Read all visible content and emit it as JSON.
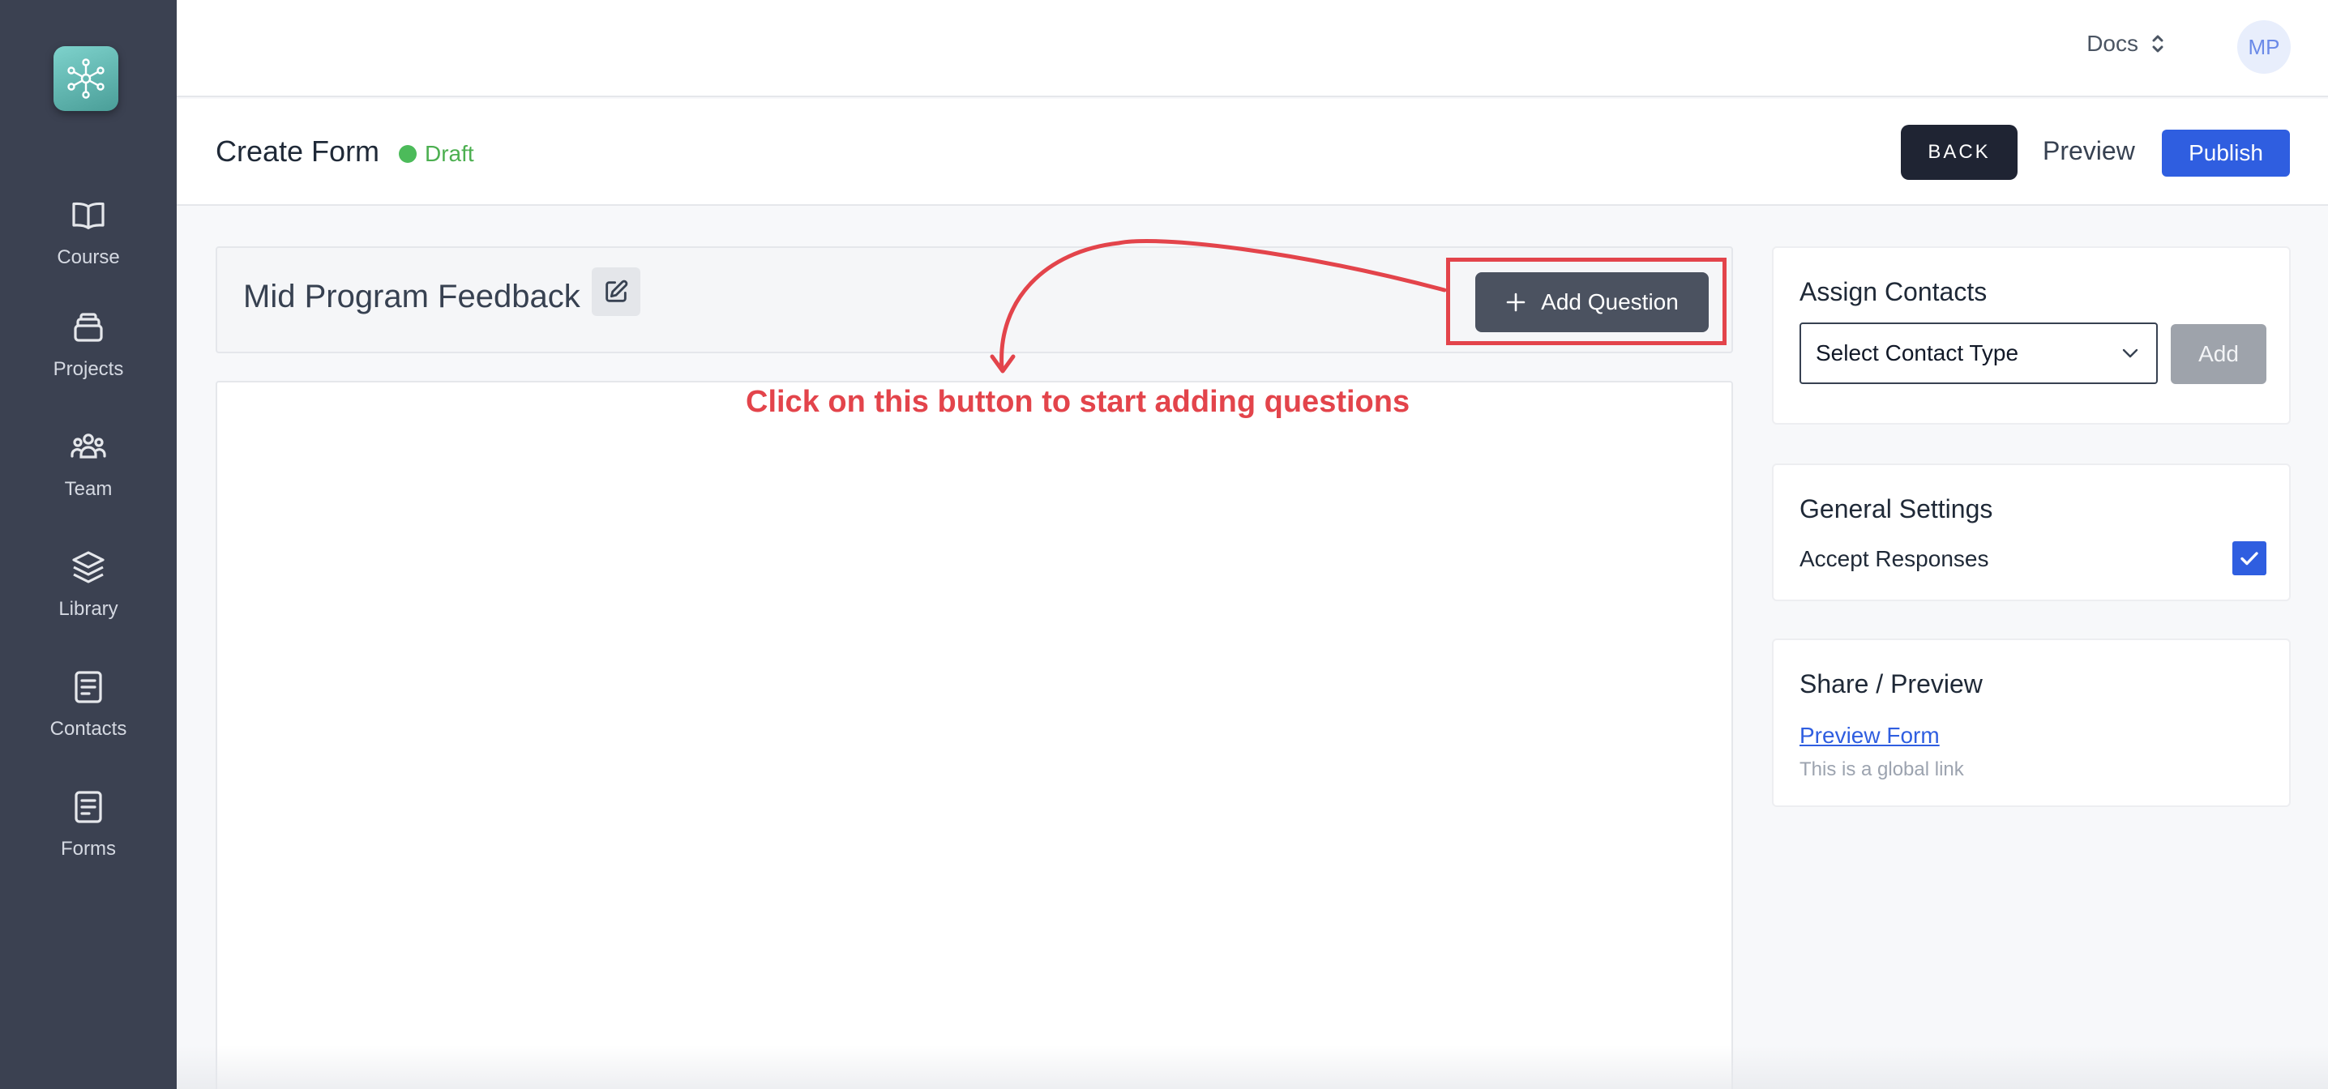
{
  "sidebar": {
    "items": [
      {
        "label": "Course",
        "icon": "book-icon"
      },
      {
        "label": "Projects",
        "icon": "archive-icon"
      },
      {
        "label": "Team",
        "icon": "users-icon"
      },
      {
        "label": "Library",
        "icon": "layers-icon"
      },
      {
        "label": "Contacts",
        "icon": "document-icon"
      },
      {
        "label": "Forms",
        "icon": "document-icon"
      }
    ]
  },
  "topbar": {
    "docs_label": "Docs",
    "avatar_initials": "MP"
  },
  "header": {
    "title": "Create Form",
    "status": "Draft",
    "back_label": "BACK",
    "preview_label": "Preview",
    "publish_label": "Publish"
  },
  "form": {
    "title": "Mid Program Feedback",
    "add_question_label": "Add Question",
    "annotation": "Click on this button to start adding questions"
  },
  "assign_contacts": {
    "title": "Assign Contacts",
    "select_value": "Select Contact Type",
    "add_label": "Add"
  },
  "general_settings": {
    "title": "General Settings",
    "accept_responses_label": "Accept Responses",
    "accept_responses_checked": true
  },
  "share_preview": {
    "title": "Share / Preview",
    "link_label": "Preview Form",
    "note": "This is a global link"
  },
  "colors": {
    "sidebar_bg": "#3b4151",
    "accent_blue": "#2f5ee0",
    "annotation_red": "#e3444b",
    "draft_green": "#4cbb5a"
  }
}
